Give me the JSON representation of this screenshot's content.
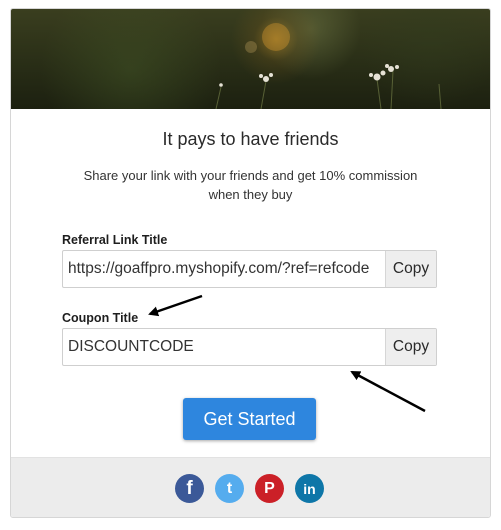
{
  "card": {
    "headline": "It pays to have friends",
    "subtext": "Share your link with your friends and get 10% commission when they buy",
    "cta_label": "Get Started"
  },
  "referral": {
    "label": "Referral Link Title",
    "value": "https://goaffpro.myshopify.com/?ref=refcode",
    "copy_label": "Copy"
  },
  "coupon": {
    "label": "Coupon Title",
    "value": "DISCOUNTCODE",
    "copy_label": "Copy"
  },
  "social": [
    {
      "icon": "facebook-icon",
      "glyph": "f",
      "color": "#3b5998"
    },
    {
      "icon": "twitter-icon",
      "glyph": "t",
      "color": "#55acee"
    },
    {
      "icon": "pinterest-icon",
      "glyph": "P",
      "color": "#cb2027"
    },
    {
      "icon": "linkedin-icon",
      "glyph": "in",
      "color": "#0e76a8"
    }
  ],
  "colors": {
    "primary": "#2e86de",
    "footer_bg": "#ececec",
    "copy_bg": "#eeeeee"
  }
}
